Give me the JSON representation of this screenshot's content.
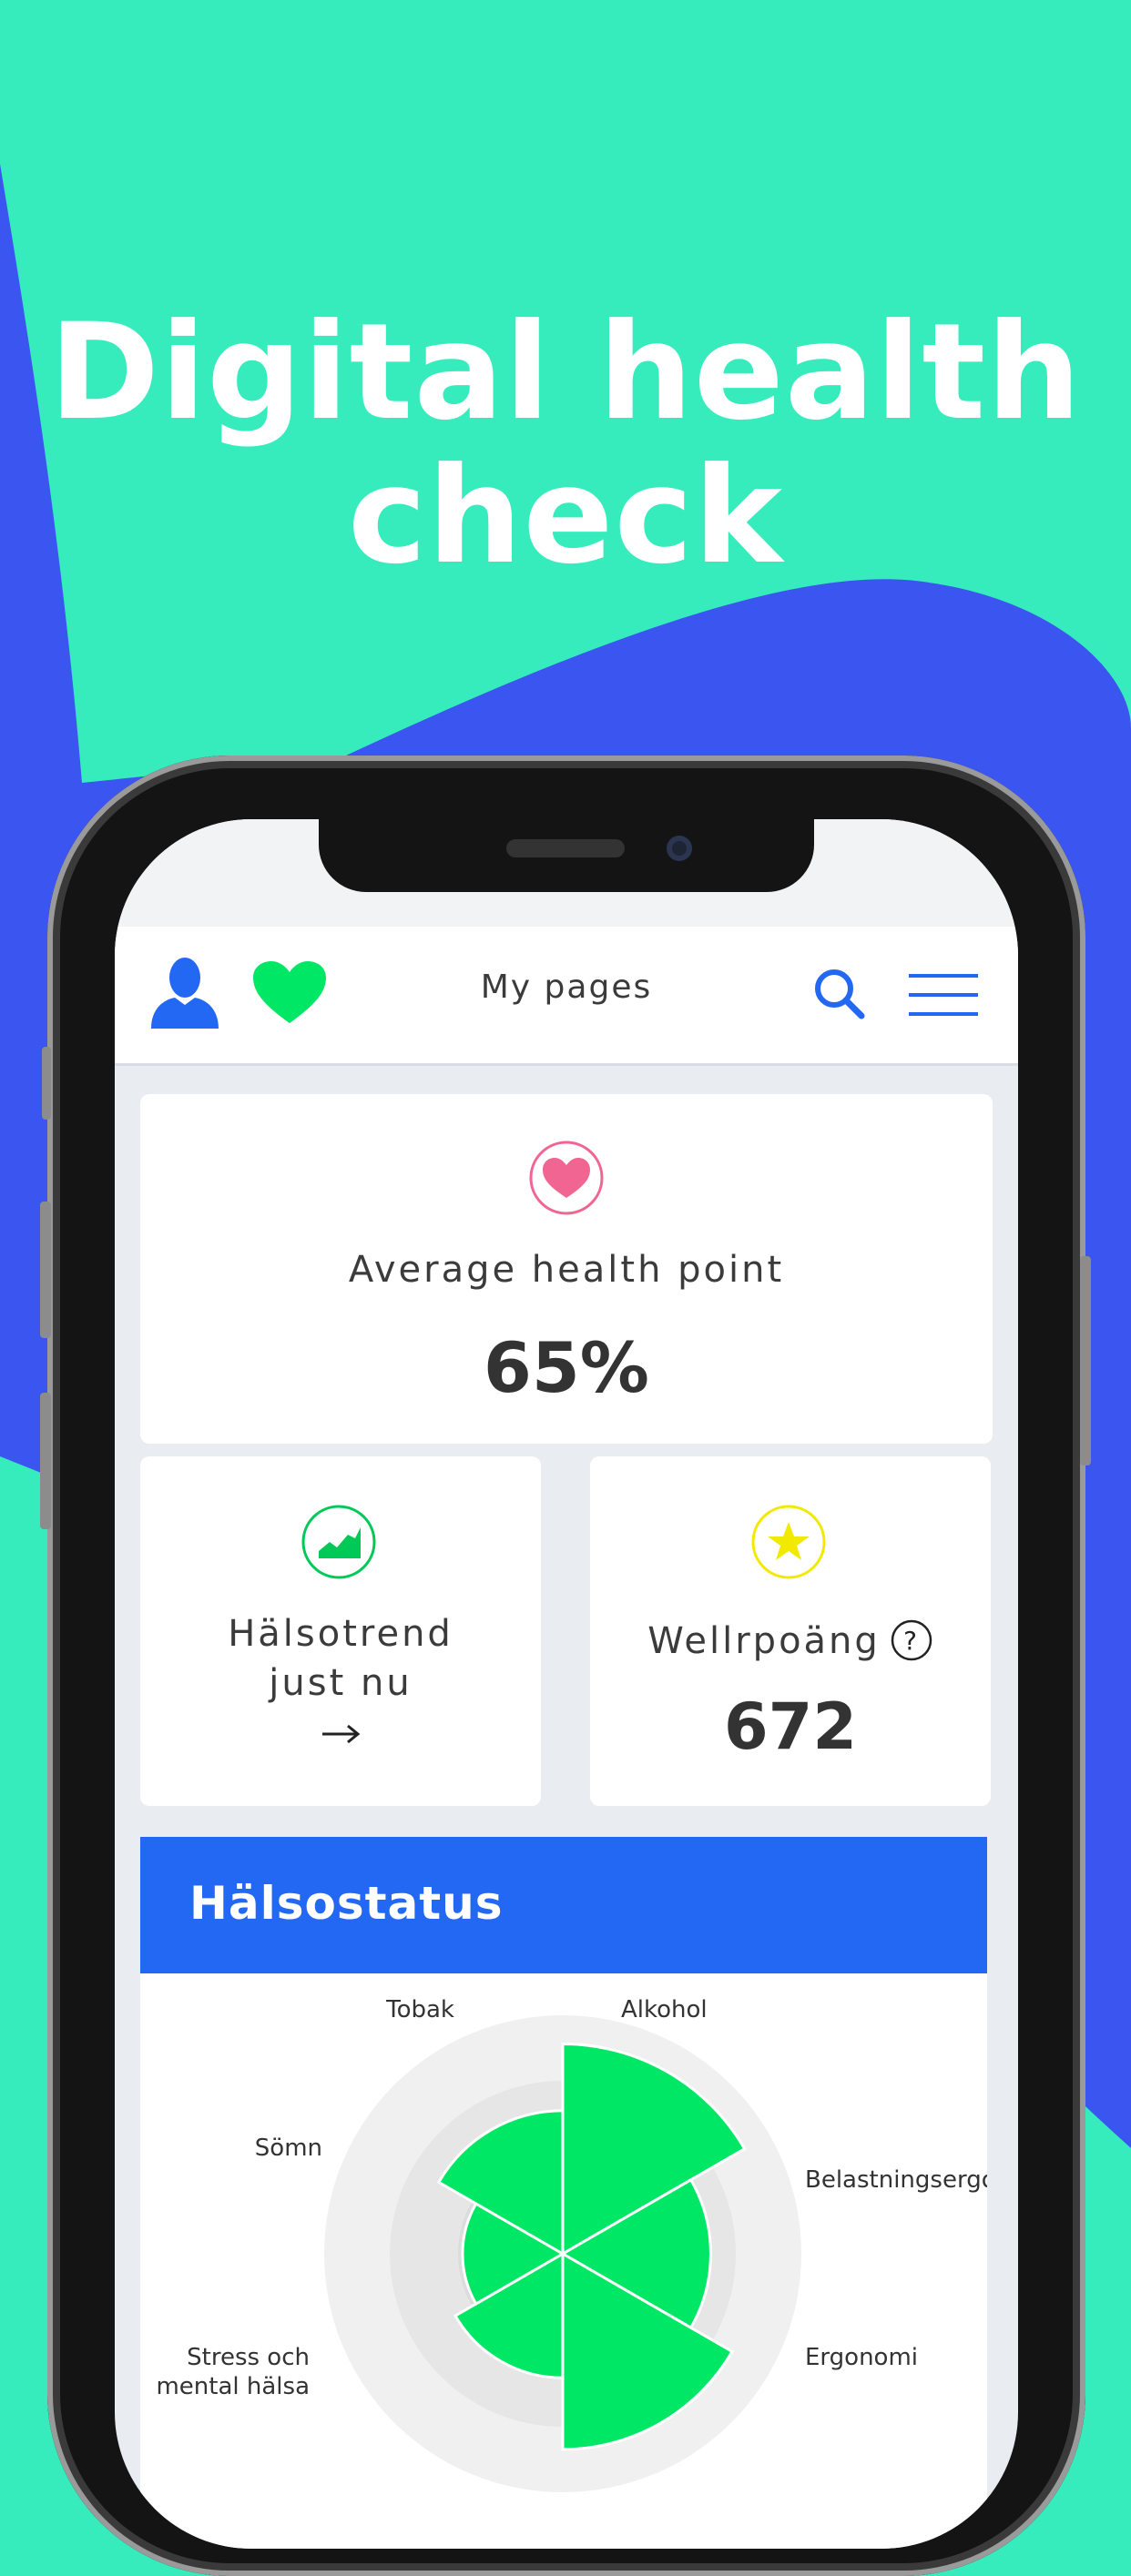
{
  "hero": {
    "line1": "Digital health",
    "line2": "check"
  },
  "colors": {
    "background": "#36ecbc",
    "shape": "#3b56f0",
    "accent_blue": "#2368f2",
    "accent_green": "#00e765",
    "heart_pink": "#f06592",
    "star_yellow": "#f2e900"
  },
  "header": {
    "title": "My pages",
    "icons": [
      "user-icon",
      "heart-icon",
      "search-icon",
      "menu-icon"
    ]
  },
  "average_card": {
    "label": "Average health point",
    "value": "65%"
  },
  "trend_card": {
    "label_line1": "Hälsotrend",
    "label_line2": "just nu",
    "arrow": "→"
  },
  "wellr_card": {
    "label": "Wellrpoäng",
    "help": "?",
    "value": "672"
  },
  "status": {
    "title": "Hälsostatus",
    "categories": [
      "Tobak",
      "Alkohol",
      "Belastningsergo",
      "Ergonomi",
      "Stress och mental hälsa",
      "Sömn"
    ]
  },
  "chart_data": {
    "type": "polar-area",
    "categories": [
      "Tobak",
      "Alkohol",
      "Belastningsergo",
      "Ergonomi",
      "Stress och mental hälsa",
      "Sömn"
    ],
    "values": [
      0.88,
      0.62,
      0.82,
      0.52,
      0.42,
      0.6
    ]
  }
}
